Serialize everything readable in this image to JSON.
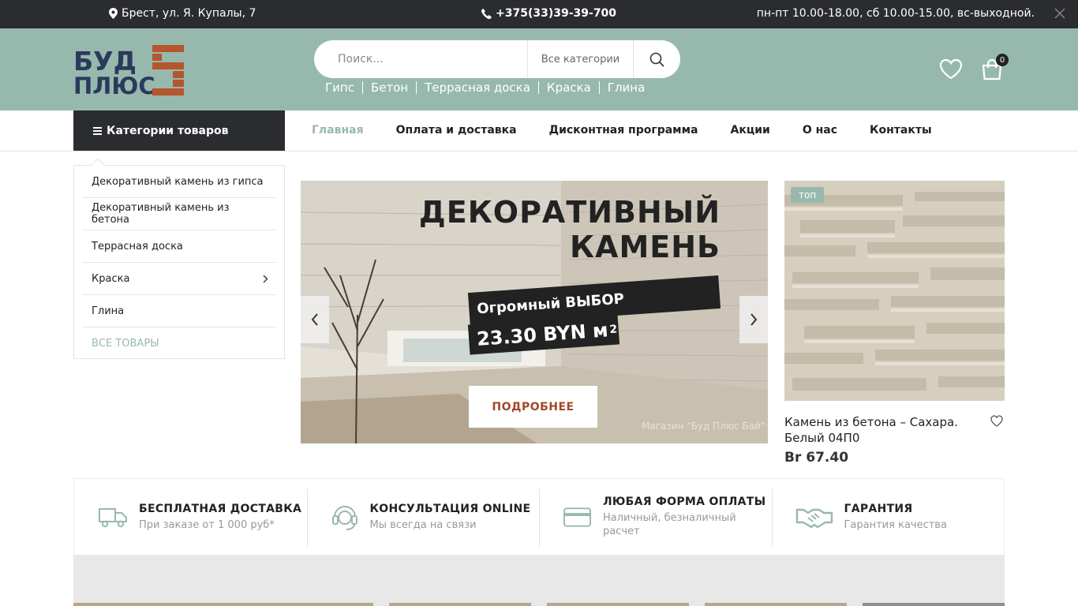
{
  "topbar": {
    "address": "Брест, ул. Я. Купалы, 7",
    "phone": "+375(33)39-39-700",
    "hours": "пн-пт 10.00-18.00, сб 10.00-15.00, вс-выходной."
  },
  "logo": {
    "line1": "БУД",
    "line2": "ПЛЮС"
  },
  "search": {
    "placeholder": "Поиск...",
    "category": "Все категории"
  },
  "quicklinks": [
    "Гипс",
    "Бетон",
    "Террасная доска",
    "Краска",
    "Глина"
  ],
  "cart": {
    "count": "0"
  },
  "nav": {
    "categories_button": "Категории товаров",
    "menu": [
      "Главная",
      "Оплата и доставка",
      "Дисконтная программа",
      "Акции",
      "О нас",
      "Контакты"
    ],
    "active_index": 0
  },
  "catalog": {
    "items": [
      "Декоративный камень из гипса",
      "Декоративный камень из бетона",
      "Террасная доска",
      "Краска",
      "Глина"
    ],
    "all_label": "ВСЕ ТОВАРЫ"
  },
  "slider": {
    "headline_line1": "ДЕКОРАТИВНЫЙ",
    "headline_line2": "КАМЕНЬ",
    "band1": "Огромный ВЫБОР",
    "band2": "23.30 BYN м",
    "band2_sup": "2",
    "button": "ПОДРОБНЕЕ",
    "watermark": "Магазин \"Буд Плюс Бай\""
  },
  "product": {
    "tag": "топ",
    "title": "Камень из бетона – Сахара. Белый 04П0",
    "price": "Br 67.40"
  },
  "features": [
    {
      "title": "БЕСПЛАТНАЯ ДОСТАВКА",
      "subtitle": "При заказе от 1 000 руб*",
      "icon": "truck-icon"
    },
    {
      "title": "КОНСУЛЬТАЦИЯ ONLINE",
      "subtitle": "Мы всегда на связи",
      "icon": "headset-icon"
    },
    {
      "title": "ЛЮБАЯ ФОРМА ОПЛАТЫ",
      "subtitle": "Наличный, безналичный расчет",
      "icon": "credit-card-icon"
    },
    {
      "title": "ГАРАНТИЯ",
      "subtitle": "Гарантия качества",
      "icon": "handshake-icon"
    }
  ],
  "colors": {
    "accent": "#97b9ad",
    "dark": "#2a2c30",
    "brand_brick": "#b5562e",
    "brand_navy": "#2b3a5c"
  }
}
